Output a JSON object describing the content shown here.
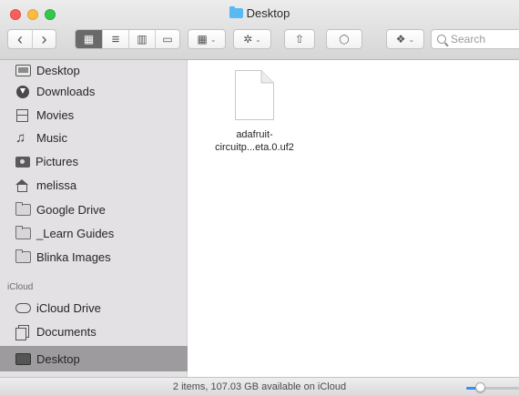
{
  "window": {
    "title": "Desktop",
    "title_icon": "folder-icon",
    "accent_color": "#3b8cf5",
    "traffic_lights": [
      "#fc605c",
      "#fdbc40",
      "#34c84a"
    ]
  },
  "toolbar": {
    "back_icon": "chevron-left-icon",
    "forward_icon": "chevron-right-icon",
    "back_glyph": "‹",
    "forward_glyph": "›",
    "view_modes": [
      {
        "name": "icon-view",
        "icon": "icon-grid-icon",
        "glyph": "▦",
        "active": true
      },
      {
        "name": "list-view",
        "icon": "list-icon",
        "glyph": "≡",
        "active": false
      },
      {
        "name": "column-view",
        "icon": "columns-icon",
        "glyph": "▥",
        "active": false
      },
      {
        "name": "gallery-view",
        "icon": "gallery-icon",
        "glyph": "▭",
        "active": false
      }
    ],
    "arrange_glyph": "▦",
    "action_glyph": "✲",
    "share_glyph": "⇧",
    "tag_glyph": "◯",
    "dropbox_glyph": "❖",
    "caret_glyph": "⌄",
    "search_placeholder": "Search"
  },
  "sidebar": {
    "items_top": [
      {
        "label": "Desktop",
        "icon": "monitor-icon"
      },
      {
        "label": "Downloads",
        "icon": "download-icon"
      },
      {
        "label": "Movies",
        "icon": "film-icon"
      },
      {
        "label": "Music",
        "icon": "music-icon"
      },
      {
        "label": "Pictures",
        "icon": "camera-icon"
      },
      {
        "label": "melissa",
        "icon": "home-icon"
      },
      {
        "label": "Google Drive",
        "icon": "folder-icon"
      },
      {
        "label": "_Learn Guides",
        "icon": "folder-icon"
      },
      {
        "label": "Blinka Images",
        "icon": "folder-icon"
      }
    ],
    "section_icloud": "iCloud",
    "items_icloud": [
      {
        "label": "iCloud Drive",
        "icon": "cloud-icon"
      },
      {
        "label": "Documents",
        "icon": "documents-icon"
      },
      {
        "label": "Desktop",
        "icon": "monitor-icon",
        "selected": true
      }
    ]
  },
  "content": {
    "files": [
      {
        "name_line1": "adafruit-",
        "name_line2": "circuitp...eta.0.uf2",
        "icon": "document-icon"
      }
    ]
  },
  "statusbar": {
    "text": "2 items, 107.03 GB available on iCloud",
    "zoom_level": 0.25
  }
}
